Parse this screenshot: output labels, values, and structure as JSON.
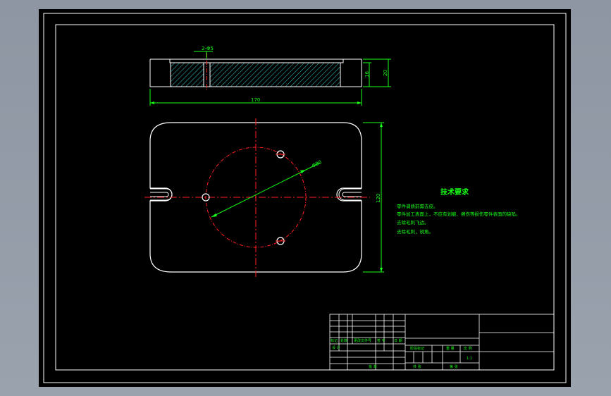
{
  "colors": {
    "background": "#000000",
    "outline": "#ffffff",
    "dimension": "#18ff18",
    "centerline": "#ff2020",
    "hatch": "#38c8c8",
    "annotation": "#18ff18"
  },
  "section_view": {
    "callout": "2-Φ5",
    "dim_width": "170",
    "dim_step": "16",
    "dim_height": "20"
  },
  "plan_view": {
    "dim_height": "120",
    "dim_diameter": "Φ80"
  },
  "technical_requirements": {
    "title": "技术要求",
    "items": [
      "零件调质前需去皮。",
      "零件加工表面上，不应有划痕、擦伤等损伤零件表面的缺陷。",
      "去除毛刺飞边。",
      "去除毛刺，锐角。"
    ]
  },
  "title_block": {
    "labels": {
      "mark": "标记",
      "count": "处数",
      "change_doc": "更改文件号",
      "signature": "签 字",
      "date": "日 期",
      "design": "设 计",
      "review": "审 核",
      "approve": "批 准",
      "stage_mark": "阶段标记",
      "weight": "重 量",
      "scale": "比 例",
      "sheets_total": "共 张",
      "sheet_no": "第 张"
    },
    "scale_value": "1:1"
  }
}
